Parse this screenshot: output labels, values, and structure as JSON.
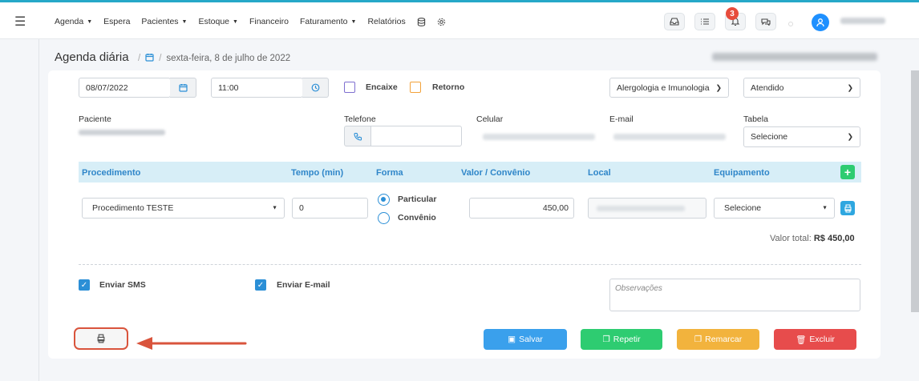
{
  "nav": {
    "items": [
      {
        "label": "Agenda",
        "caret": true
      },
      {
        "label": "Espera",
        "caret": false
      },
      {
        "label": "Pacientes",
        "caret": true
      },
      {
        "label": "Estoque",
        "caret": true
      },
      {
        "label": "Financeiro",
        "caret": false
      },
      {
        "label": "Faturamento",
        "caret": true
      },
      {
        "label": "Relatórios",
        "caret": false
      }
    ],
    "notification_count": "3"
  },
  "page": {
    "title": "Agenda diária",
    "breadcrumb_date": "sexta-feira, 8 de julho de 2022"
  },
  "form": {
    "date": "08/07/2022",
    "time": "11:00",
    "encaixe_label": "Encaixe",
    "retorno_label": "Retorno",
    "specialty": "Alergologia e Imunologia",
    "status": "Atendido",
    "paciente_label": "Paciente",
    "telefone_label": "Telefone",
    "celular_label": "Celular",
    "email_label": "E-mail",
    "tabela_label": "Tabela",
    "tabela_value": "Selecione"
  },
  "procedures": {
    "headers": {
      "procedimento": "Procedimento",
      "tempo": "Tempo (min)",
      "forma": "Forma",
      "valor": "Valor / Convênio",
      "local": "Local",
      "equipamento": "Equipamento"
    },
    "row": {
      "procedimento": "Procedimento TESTE",
      "tempo": "0",
      "forma_particular": "Particular",
      "forma_convenio": "Convênio",
      "valor": "450,00",
      "equipamento": "Selecione"
    },
    "total_label": "Valor total:",
    "total_value": "R$ 450,00"
  },
  "options": {
    "sms_label": "Enviar SMS",
    "email_label": "Enviar E-mail",
    "obs_placeholder": "Observações"
  },
  "actions": {
    "salvar": "Salvar",
    "repetir": "Repetir",
    "remarcar": "Remarcar",
    "excluir": "Excluir"
  },
  "colors": {
    "salvar": "#3aa0ec",
    "repetir": "#2ecc71",
    "remarcar": "#f2b33d",
    "excluir": "#e74c4c",
    "accent": "#2b8fd6"
  }
}
